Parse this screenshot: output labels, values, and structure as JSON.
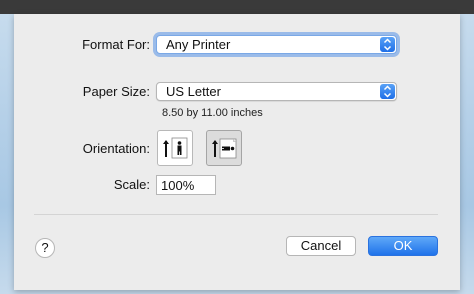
{
  "dialog": {
    "format_for": {
      "label": "Format For:",
      "value": "Any Printer"
    },
    "paper_size": {
      "label": "Paper Size:",
      "value": "US Letter",
      "dimensions": "8.50 by 11.00 inches"
    },
    "orientation": {
      "label": "Orientation:",
      "options": [
        "portrait",
        "landscape"
      ],
      "selected": "landscape"
    },
    "scale": {
      "label": "Scale:",
      "value": "100%"
    },
    "buttons": {
      "help": "?",
      "cancel": "Cancel",
      "ok": "OK"
    }
  },
  "colors": {
    "accent": "#1f72ea",
    "dialog_bg": "#ececec"
  },
  "icons": [
    "up-down-chevron-icon",
    "portrait-person-icon",
    "landscape-person-icon",
    "help-icon"
  ]
}
